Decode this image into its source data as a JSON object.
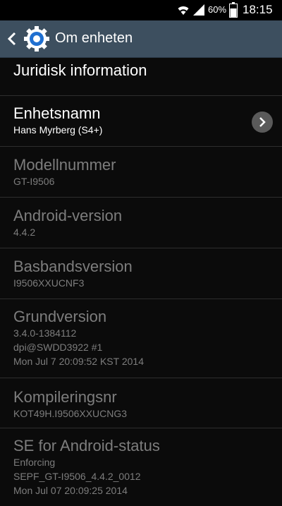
{
  "status_bar": {
    "battery_percent": "60%",
    "time": "18:15",
    "icons": [
      "wifi-icon",
      "signal-icon",
      "battery-icon"
    ]
  },
  "action_bar": {
    "title": "Om enheten",
    "icon": "settings-gear-icon"
  },
  "items": [
    {
      "title": "Juridisk information",
      "lines": []
    },
    {
      "title": "Enhetsnamn",
      "lines": [
        "Hans Myrberg (S4+)"
      ]
    },
    {
      "title": "Modellnummer",
      "lines": [
        "GT-I9506"
      ]
    },
    {
      "title": "Android-version",
      "lines": [
        "4.4.2"
      ]
    },
    {
      "title": "Basbandsversion",
      "lines": [
        "I9506XXUCNF3"
      ]
    },
    {
      "title": "Grundversion",
      "lines": [
        "3.4.0-1384112",
        "dpi@SWDD3922 #1",
        "Mon Jul 7 20:09:52 KST 2014"
      ]
    },
    {
      "title": "Kompileringsnr",
      "lines": [
        "KOT49H.I9506XXUCNG3"
      ]
    },
    {
      "title": "SE for Android-status",
      "lines": [
        "Enforcing",
        "SEPF_GT-I9506_4.4.2_0012",
        "Mon Jul 07 20:09:25 2014"
      ]
    }
  ],
  "colors": {
    "action_bar": "#3d4f5f",
    "background": "#0b0b0b",
    "disabled_text": "#7d7d7d",
    "gear_blue": "#1f6fd0"
  }
}
